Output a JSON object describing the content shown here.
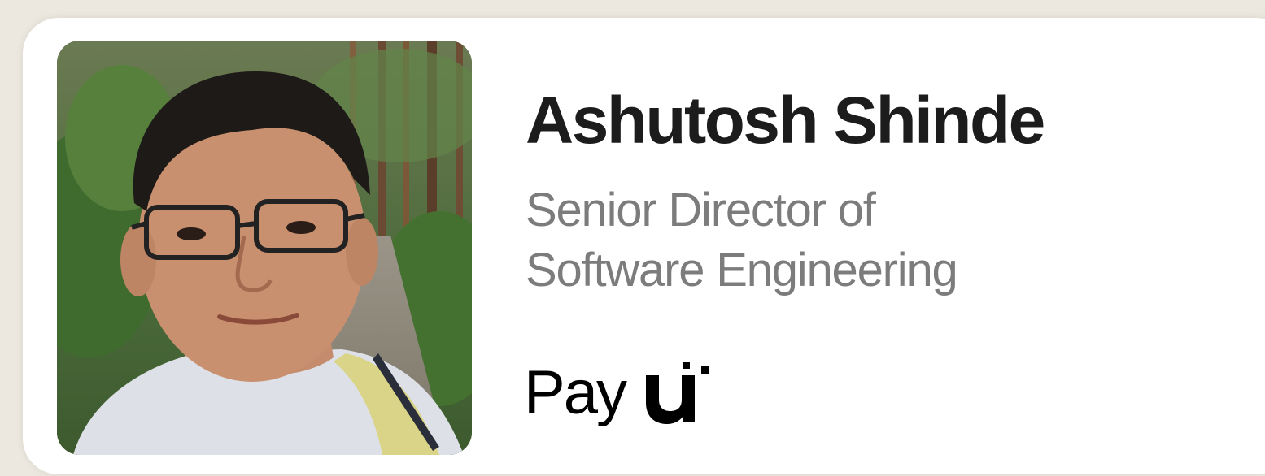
{
  "profile": {
    "name": "Ashutosh Shinde",
    "role_line1": "Senior Director of",
    "role_line2": "Software Engineering",
    "company_logo_text": "Pay",
    "company_logo_name": "PayU"
  },
  "colors": {
    "background": "#ece8df",
    "card": "#ffffff",
    "name": "#1c1c1c",
    "role": "#7c7c7c",
    "logo": "#000000"
  },
  "icons": {
    "photo": "profile-photo",
    "logo": "payu-logo"
  }
}
